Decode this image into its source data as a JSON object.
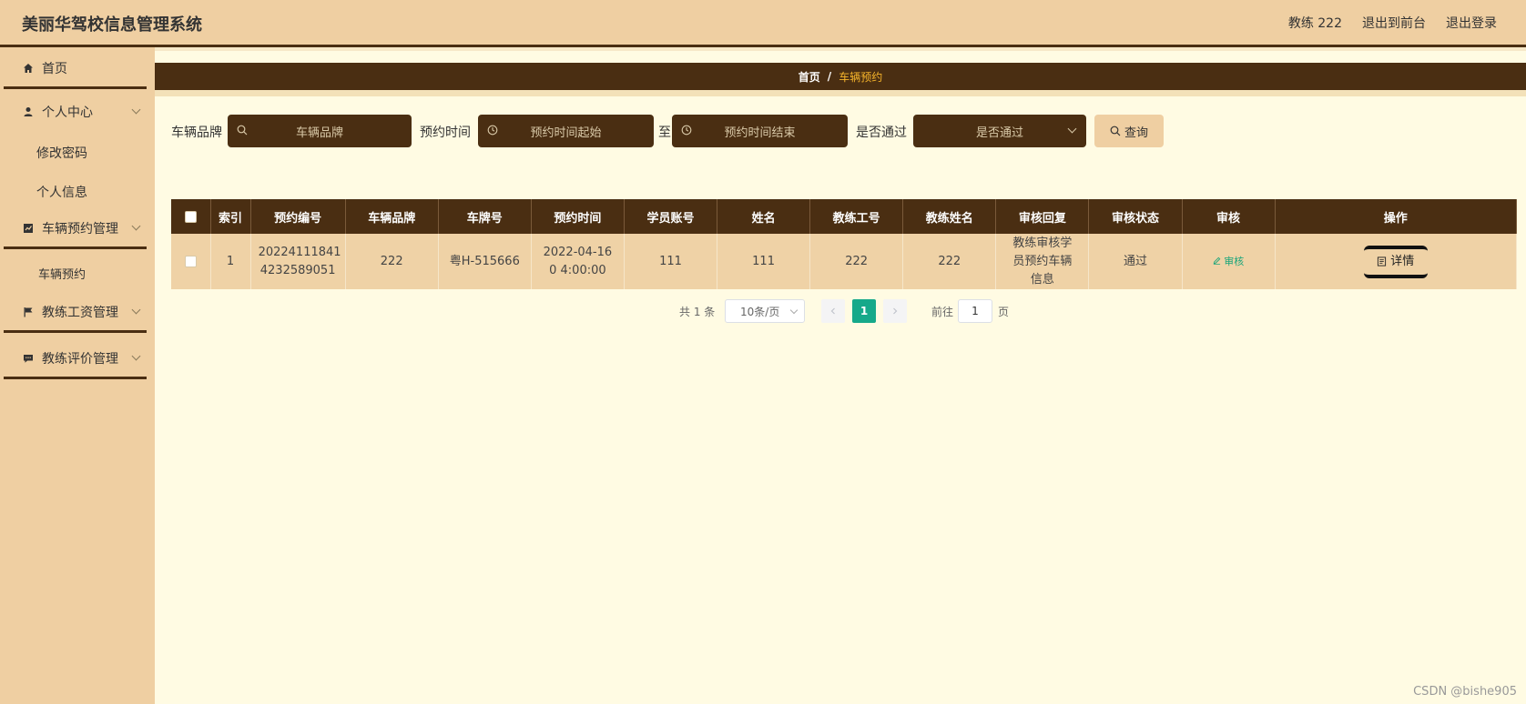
{
  "header": {
    "title": "美丽华驾校信息管理系统",
    "user": "教练 222",
    "to_front": "退出到前台",
    "logout": "退出登录"
  },
  "sidebar": {
    "home": "首页",
    "personal_center": "个人中心",
    "change_password": "修改密码",
    "personal_info": "个人信息",
    "vehicle_booking_mgmt": "车辆预约管理",
    "vehicle_booking": "车辆预约",
    "coach_salary_mgmt": "教练工资管理",
    "coach_eval_mgmt": "教练评价管理"
  },
  "breadcrumb": {
    "home": "首页",
    "separator": "/",
    "current": "车辆预约"
  },
  "search": {
    "brand_label": "车辆品牌",
    "brand_placeholder": "车辆品牌",
    "time_label": "预约时间",
    "time_start_placeholder": "预约时间起始",
    "to_label": "至",
    "time_end_placeholder": "预约时间结束",
    "pass_label": "是否通过",
    "pass_placeholder": "是否通过",
    "query_button": "查询"
  },
  "table": {
    "headers": [
      "索引",
      "预约编号",
      "车辆品牌",
      "车牌号",
      "预约时间",
      "学员账号",
      "姓名",
      "教练工号",
      "教练姓名",
      "审核回复",
      "审核状态",
      "审核",
      "操作"
    ],
    "rows": [
      {
        "index": "1",
        "booking_no": "20224111841 4232589051",
        "brand": "222",
        "plate": "粤H-515666",
        "time": "2022-04-16 0 4:00:00",
        "student_account": "111",
        "name": "111",
        "coach_id": "222",
        "coach_name": "222",
        "reply": "教练审核学员预约车辆信息",
        "status": "通过",
        "audit": "审核",
        "detail": "详情"
      }
    ]
  },
  "pagination": {
    "total": "共 1 条",
    "page_size": "10条/页",
    "current_page": "1",
    "goto_label": "前往",
    "goto_value": "1",
    "page_suffix": "页"
  },
  "watermark": "CSDN @bishe905",
  "colors": {
    "header_bg": "#efcfa2",
    "dark_brown": "#4a2e12",
    "main_bg": "#fffbe3",
    "row_bg": "#efd2a6",
    "accent_gold": "#f7b52b",
    "page_active": "#16a98a"
  }
}
